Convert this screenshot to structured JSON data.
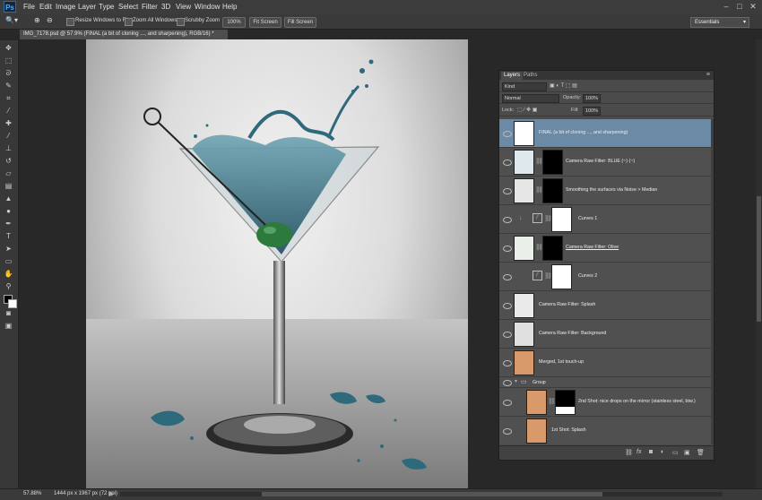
{
  "app": {
    "logo": "Ps"
  },
  "menu": [
    "File",
    "Edit",
    "Image",
    "Layer",
    "Type",
    "Select",
    "Filter",
    "3D",
    "View",
    "Window",
    "Help"
  ],
  "options": {
    "resize_windows": "Resize Windows to Fit",
    "zoom_all": "Zoom All Windows",
    "scrubby": "Scrubby Zoom",
    "pct": "100%",
    "fit": "Fit Screen",
    "fill": "Fill Screen"
  },
  "workspace": "Essentials",
  "document": {
    "tab": "IMG_7178.psd @ 57.9% (FINAL (a bit of cloning ..., and sharpening), RGB/16) *"
  },
  "status": {
    "zoom": "57.88%",
    "doc": "1444 px x 1967 px (72 ppi)"
  },
  "panel": {
    "tabs": [
      "Layers",
      "Paths"
    ],
    "kind": "Kind",
    "blend": "Normal",
    "opacity_label": "Opacity:",
    "opacity": "100%",
    "lock_label": "Lock:",
    "fill_label": "Fill:",
    "fill": "100%"
  },
  "layers": [
    {
      "name": "FINAL (a bit of cloning ..., and sharpening)",
      "thumb": "glass",
      "selected": true
    },
    {
      "name": "Camera Raw Filter: BLUE (~) (~)",
      "thumb": "glass",
      "mask": "black-splash"
    },
    {
      "name": "Smoothing the surfaces via Noise > Median",
      "thumb": "glass",
      "mask": "black-splash"
    },
    {
      "name": "Curves 1",
      "thumb": "curves",
      "mask": "white"
    },
    {
      "name": "Camera Raw Filter: Olive",
      "thumb": "glass-green",
      "mask": "black-dot"
    },
    {
      "name": "Curves 2",
      "thumb": "curves",
      "mask": "white"
    },
    {
      "name": "Camera Raw Filter: Splash",
      "thumb": "glass"
    },
    {
      "name": "Camera Raw Filter: Background",
      "thumb": "glass"
    },
    {
      "name": "Merged, 1st touch-up",
      "thumb": "glass-orange"
    },
    {
      "name": "Group",
      "thumb": "group"
    },
    {
      "name": "2nd Shot: nice drops on the mirror (stainless steel, btw.)",
      "thumb": "glass-orange",
      "mask": "black-bottom"
    },
    {
      "name": "1st Shot: Splash",
      "thumb": "glass-orange"
    }
  ]
}
